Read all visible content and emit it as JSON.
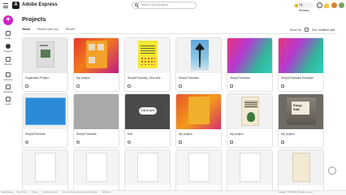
{
  "app": {
    "title": "Adobe Express",
    "logo_letter": "A"
  },
  "search": {
    "placeholder": "Search your projects"
  },
  "header": {
    "premium_label": "Try Premium",
    "help_glyph": "?"
  },
  "sidebar": {
    "create_glyph": "+",
    "items": [
      {
        "label": "Home",
        "icon": "home-icon"
      },
      {
        "label": "Projects",
        "icon": "projects-icon"
      },
      {
        "label": "Brands",
        "icon": "brands-icon"
      },
      {
        "label": "Libraries",
        "icon": "libraries-icon"
      },
      {
        "label": "Schedule",
        "icon": "schedule-icon"
      },
      {
        "label": "Learn",
        "icon": "learn-icon"
      }
    ]
  },
  "page": {
    "title": "Projects"
  },
  "tabs": [
    {
      "label": "Yours",
      "active": true
    },
    {
      "label": "Shared with you",
      "active": false
    },
    {
      "label": "Recent",
      "active": false
    }
  ],
  "controls": {
    "show_label": "Show: All",
    "sort_label": "Sort: Modified date"
  },
  "cards": [
    {
      "name": "Duplicated Project",
      "thumb": "grey-flyer"
    },
    {
      "name": "My project",
      "thumb": "orange-collage"
    },
    {
      "name": "SimpleTutorials_Grid des...",
      "thumb": "yellow-poster"
    },
    {
      "name": "SimpleTutorials",
      "thumb": "palm-tree"
    },
    {
      "name": "SimpleTutorials",
      "thumb": "blurred-gradient"
    },
    {
      "name": "SimpleTutorials Example",
      "thumb": "blurred-gradient"
    },
    {
      "name": "SimpleTutorials",
      "thumb": "blue-frame"
    },
    {
      "name": "SimpleTutorials",
      "thumb": "grey-solid"
    },
    {
      "name": "Edit",
      "thumb": "dark-bubble",
      "bubble_text": "Edit project"
    },
    {
      "name": "My project",
      "thumb": "orange-collage"
    },
    {
      "name": "My project",
      "thumb": "book-cover"
    },
    {
      "name": "My project",
      "thumb": "stoop-sale",
      "sign_text": "Stoop Sale"
    },
    {
      "name": "",
      "thumb": "white-page"
    },
    {
      "name": "",
      "thumb": "white-page"
    },
    {
      "name": "",
      "thumb": "white-page"
    },
    {
      "name": "",
      "thumb": "white-page"
    },
    {
      "name": "",
      "thumb": "white-page"
    },
    {
      "name": "",
      "thumb": "white-page"
    }
  ],
  "footer": {
    "left": "Adobe Express",
    "links": [
      "Terms of Use",
      "Privacy",
      "Cookie preferences",
      "Do not sell or share my personal information",
      "AdChoices"
    ],
    "right": "Copyright © 2024 Adobe. All rights reserved."
  }
}
